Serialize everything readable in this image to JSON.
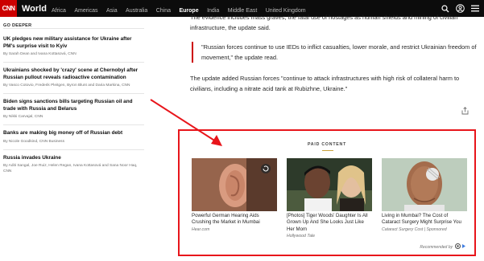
{
  "header": {
    "logo": "CNN",
    "section": "World",
    "nav": [
      "Africa",
      "Americas",
      "Asia",
      "Australia",
      "China",
      "Europe",
      "India",
      "Middle East",
      "United Kingdom"
    ],
    "active_nav": "Europe"
  },
  "sidebar": {
    "heading": "GO DEEPER",
    "stories": [
      {
        "title": "UK pledges new military assistance for Ukraine after PM's surprise visit to Kyiv",
        "byline": "By Sarah Dean and Ivana Kottasová, CNN"
      },
      {
        "title": "Ukrainians shocked by 'crazy' scene at Chernobyl after Russian pullout reveals radioactive contamination",
        "byline": "By Vasco Cotovio, Frederik Pleitgen, Byron Blunt and Daria Markina, CNN"
      },
      {
        "title": "Biden signs sanctions bills targeting Russian oil and trade with Russia and Belarus",
        "byline": "By Nikki Carvajal, CNN"
      },
      {
        "title": "Banks are making big money off of Russian debt",
        "byline": "By Nicole Goodkind, CNN Business"
      },
      {
        "title": "Russia invades Ukraine",
        "byline": "By Aditi Sangal, Joe Ruiz, Helen Regan, Ivana Kottasová and Sana Noor Haq, CNN"
      }
    ]
  },
  "article": {
    "p1": "The evidence includes mass graves, the fatal use of hostages as human shields and mining of civilian infrastructure, the update said.",
    "quote": "\"Russian forces continue to use IEDs to inflict casualties, lower morale, and restrict Ukrainian freedom of movement,\" the update read.",
    "p2": "The update added Russian forces \"continue to attack infrastructures with high risk of collateral harm to civilians, including a nitrate acid tank at Rubizhne, Ukraine.\""
  },
  "paid": {
    "label": "PAID CONTENT",
    "cards": [
      {
        "title": "Powerful German Hearing Aids Crushing the Market in Mumbai",
        "source": "Hear.com"
      },
      {
        "title": "[Photos] Tiger Woods' Daughter Is All Grown Up And She Looks Just Like Her Mom",
        "source": "Hollywood Tale"
      },
      {
        "title": "Living in Mumbai? The Cost of Cataract Surgery Might Surprise You",
        "source": "Cataract Surgery Cost | Sponsored"
      }
    ],
    "recommended": "Recommended by"
  },
  "colors": {
    "accent": "#cc0000",
    "highlight_box": "#e8151b",
    "header_bg": "#0c0c0c"
  },
  "icons": [
    "search-icon",
    "account-icon",
    "menu-icon",
    "share-icon",
    "play-icon",
    "outbrain-icon"
  ]
}
